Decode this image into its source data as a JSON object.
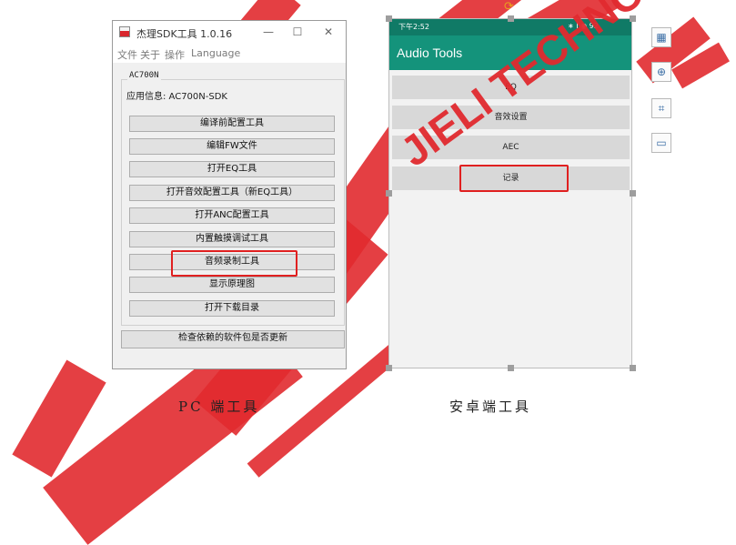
{
  "pc_window": {
    "title": "杰理SDK工具 1.0.16",
    "controls": {
      "minimize": "—",
      "maximize": "☐",
      "close": "✕"
    },
    "menu": [
      "文件",
      "关于",
      "操作",
      "Language"
    ],
    "group_label": "AC700N",
    "app_info": "应用信息: AC700N-SDK",
    "buttons": [
      "编译前配置工具",
      "编辑FW文件",
      "打开EQ工具",
      "打开音效配置工具（新EQ工具）",
      "打开ANC配置工具",
      "内置触摸调试工具",
      "音频录制工具",
      "显示原理图",
      "打开下载目录"
    ],
    "check_button": "检查依赖的软件包是否更新",
    "highlighted_button_index": 6
  },
  "phone": {
    "status_time": "下午2:52",
    "status_icons": "∗ ꟾ ◉ 92",
    "app_title": "Audio Tools",
    "buttons": [
      "EQ",
      "音效设置",
      "AEC",
      "记录"
    ],
    "highlighted_button_index": 3
  },
  "side_toolbar": [
    "image-options-icon",
    "zoom-icon",
    "crop-icon",
    "frame-icon"
  ],
  "captions": {
    "left": "PC 端工具",
    "right": "安卓端工具"
  },
  "watermark_text": "JIELI TECHNOLOGY",
  "colors": {
    "watermark": "#e12a2f",
    "highlight": "#e02020",
    "phone_appbar": "#14937b",
    "phone_status": "#107a66"
  }
}
